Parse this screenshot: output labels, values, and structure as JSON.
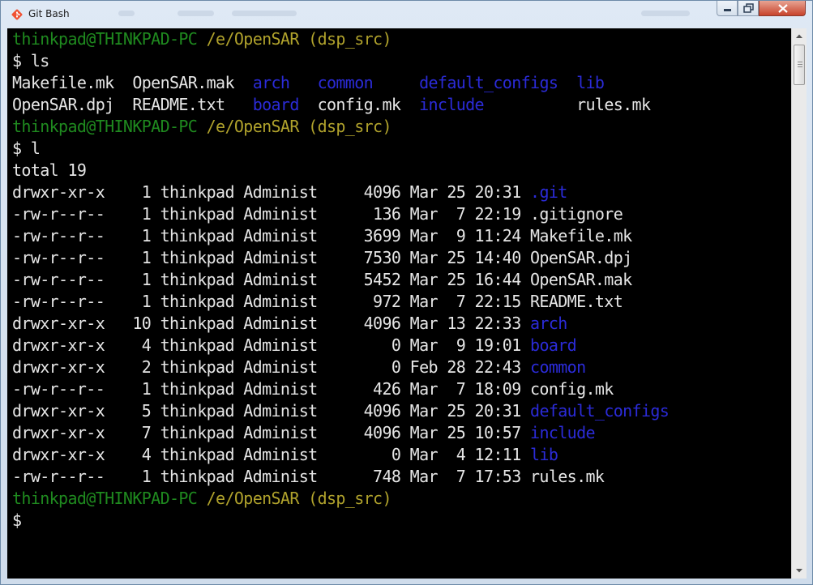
{
  "window": {
    "title": "Git Bash",
    "icon": "git-diamond-icon",
    "accent": "#f05133"
  },
  "colors": {
    "terminal_bg": "#000000",
    "text": "#e6e6e6",
    "prompt_user": "#1f8a1f",
    "prompt_path": "#b0a22c",
    "directory": "#2b2bd8"
  },
  "terminal": {
    "lines": [
      [
        {
          "t": "thinkpad@THINKPAD-PC ",
          "c": "green"
        },
        {
          "t": "/e/OpenSAR (dsp_src)",
          "c": "yellow"
        }
      ],
      [
        {
          "t": "$ ls",
          "c": ""
        }
      ],
      [
        {
          "t": "Makefile.mk  OpenSAR.mak  ",
          "c": ""
        },
        {
          "t": "arch",
          "c": "blue"
        },
        {
          "t": "   ",
          "c": ""
        },
        {
          "t": "common",
          "c": "blue"
        },
        {
          "t": "     ",
          "c": ""
        },
        {
          "t": "default_configs",
          "c": "blue"
        },
        {
          "t": "  ",
          "c": ""
        },
        {
          "t": "lib",
          "c": "blue"
        }
      ],
      [
        {
          "t": "OpenSAR.dpj  README.txt   ",
          "c": ""
        },
        {
          "t": "board",
          "c": "blue"
        },
        {
          "t": "  config.mk  ",
          "c": ""
        },
        {
          "t": "include",
          "c": "blue"
        },
        {
          "t": "          rules.mk",
          "c": ""
        }
      ],
      [
        {
          "t": "thinkpad@THINKPAD-PC ",
          "c": "green"
        },
        {
          "t": "/e/OpenSAR (dsp_src)",
          "c": "yellow"
        }
      ],
      [
        {
          "t": "$ l",
          "c": ""
        }
      ],
      [
        {
          "t": "total 19",
          "c": ""
        }
      ],
      [
        {
          "t": "drwxr-xr-x    1 thinkpad Administ     4096 Mar 25 20:31 ",
          "c": ""
        },
        {
          "t": ".git",
          "c": "blue"
        }
      ],
      [
        {
          "t": "-rw-r--r--    1 thinkpad Administ      136 Mar  7 22:19 .gitignore",
          "c": ""
        }
      ],
      [
        {
          "t": "-rw-r--r--    1 thinkpad Administ     3699 Mar  9 11:24 Makefile.mk",
          "c": ""
        }
      ],
      [
        {
          "t": "-rw-r--r--    1 thinkpad Administ     7530 Mar 25 14:40 OpenSAR.dpj",
          "c": ""
        }
      ],
      [
        {
          "t": "-rw-r--r--    1 thinkpad Administ     5452 Mar 25 16:44 OpenSAR.mak",
          "c": ""
        }
      ],
      [
        {
          "t": "-rw-r--r--    1 thinkpad Administ      972 Mar  7 22:15 README.txt",
          "c": ""
        }
      ],
      [
        {
          "t": "drwxr-xr-x   10 thinkpad Administ     4096 Mar 13 22:33 ",
          "c": ""
        },
        {
          "t": "arch",
          "c": "blue"
        }
      ],
      [
        {
          "t": "drwxr-xr-x    4 thinkpad Administ        0 Mar  9 19:01 ",
          "c": ""
        },
        {
          "t": "board",
          "c": "blue"
        }
      ],
      [
        {
          "t": "drwxr-xr-x    2 thinkpad Administ        0 Feb 28 22:43 ",
          "c": ""
        },
        {
          "t": "common",
          "c": "blue"
        }
      ],
      [
        {
          "t": "-rw-r--r--    1 thinkpad Administ      426 Mar  7 18:09 config.mk",
          "c": ""
        }
      ],
      [
        {
          "t": "drwxr-xr-x    5 thinkpad Administ     4096 Mar 25 20:31 ",
          "c": ""
        },
        {
          "t": "default_configs",
          "c": "blue"
        }
      ],
      [
        {
          "t": "drwxr-xr-x    7 thinkpad Administ     4096 Mar 25 10:57 ",
          "c": ""
        },
        {
          "t": "include",
          "c": "blue"
        }
      ],
      [
        {
          "t": "drwxr-xr-x    4 thinkpad Administ        0 Mar  4 12:11 ",
          "c": ""
        },
        {
          "t": "lib",
          "c": "blue"
        }
      ],
      [
        {
          "t": "-rw-r--r--    1 thinkpad Administ      748 Mar  7 17:53 rules.mk",
          "c": ""
        }
      ],
      [
        {
          "t": "thinkpad@THINKPAD-PC ",
          "c": "green"
        },
        {
          "t": "/e/OpenSAR (dsp_src)",
          "c": "yellow"
        }
      ],
      [
        {
          "t": "$",
          "c": ""
        }
      ]
    ]
  }
}
